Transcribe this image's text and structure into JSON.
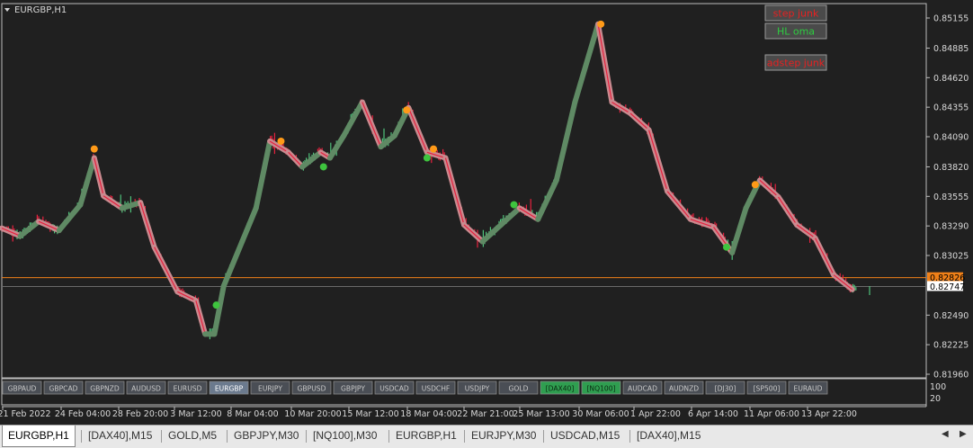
{
  "chart": {
    "title": "EURGBP,H1",
    "collapse_icon": "triangle-down-icon",
    "price_ticks": [
      "0.85155",
      "0.84885",
      "0.84620",
      "0.84355",
      "0.84090",
      "0.83820",
      "0.83555",
      "0.83290",
      "0.83025",
      "0.82490",
      "0.82225",
      "0.81960"
    ],
    "price_tick_values": [
      0.85155,
      0.84885,
      0.8462,
      0.84355,
      0.8409,
      0.8382,
      0.83555,
      0.8329,
      0.83025,
      0.8249,
      0.82225,
      0.8196
    ],
    "orange_price": "0.82826",
    "current_price": "0.82747",
    "time_ticks": [
      "21 Feb 2022",
      "24 Feb 04:00",
      "28 Feb 20:00",
      "3 Mar 12:00",
      "8 Mar 04:00",
      "10 Mar 20:00",
      "15 Mar 12:00",
      "18 Mar 04:00",
      "22 Mar 21:00",
      "25 Mar 13:00",
      "30 Mar 06:00",
      "1 Apr 22:00",
      "6 Apr 14:00",
      "11 Apr 06:00",
      "13 Apr 22:00"
    ],
    "subwindow_ticks": [
      "100",
      "20"
    ],
    "colors": {
      "background": "#202020",
      "up_bars": "#4fc27a",
      "down_bars": "#e8203e",
      "trend_up": "#5f8a64",
      "trend_down": "#c98a8f",
      "orange_line": "#f08018",
      "marker_orange": "#ff9a18",
      "marker_green": "#3ec43e"
    },
    "indicator_buttons": [
      {
        "label": "step junk",
        "text_color": "#e82020",
        "bg": "#4a4a4a",
        "icon": ""
      },
      {
        "label": "HL oma",
        "text_color": "#2ecc40",
        "bg": "#4a4a4a",
        "icon": ""
      },
      {
        "label": "adstep junk",
        "text_color": "#e82020",
        "bg": "#4a4a4a",
        "icon": ""
      }
    ]
  },
  "symbol_buttons": [
    {
      "label": "GBPAUD",
      "state": "normal"
    },
    {
      "label": "GBPCAD",
      "state": "normal"
    },
    {
      "label": "GBPNZD",
      "state": "normal"
    },
    {
      "label": "AUDUSD",
      "state": "normal"
    },
    {
      "label": "EURUSD",
      "state": "normal"
    },
    {
      "label": "EURGBP",
      "state": "selected"
    },
    {
      "label": "EURJPY",
      "state": "normal"
    },
    {
      "label": "GBPUSD",
      "state": "normal"
    },
    {
      "label": "GBPJPY",
      "state": "normal"
    },
    {
      "label": "USDCAD",
      "state": "normal"
    },
    {
      "label": "USDCHF",
      "state": "normal"
    },
    {
      "label": "USDJPY",
      "state": "normal"
    },
    {
      "label": "GOLD",
      "state": "normal"
    },
    {
      "label": "[DAX40]",
      "state": "green"
    },
    {
      "label": "[NQ100]",
      "state": "green"
    },
    {
      "label": "AUDCAD",
      "state": "normal"
    },
    {
      "label": "AUDNZD",
      "state": "normal"
    },
    {
      "label": "[DJ30]",
      "state": "normal"
    },
    {
      "label": "[SP500]",
      "state": "normal"
    },
    {
      "label": "EURAUD",
      "state": "normal"
    }
  ],
  "tabs": [
    {
      "label": "EURGBP,H1",
      "active": true
    },
    {
      "label": "[DAX40],M15",
      "active": false
    },
    {
      "label": "GOLD,M5",
      "active": false
    },
    {
      "label": "GBPJPY,M30",
      "active": false
    },
    {
      "label": "[NQ100],M30",
      "active": false
    },
    {
      "label": "EURGBP,H1",
      "active": false
    },
    {
      "label": "EURJPY,M30",
      "active": false
    },
    {
      "label": "USDCAD,M15",
      "active": false
    },
    {
      "label": "[DAX40],M15",
      "active": false
    }
  ],
  "tab_scroll": {
    "left_icon": "arrow-left-icon",
    "right_icon": "arrow-right-icon"
  },
  "chart_data": {
    "type": "line",
    "title": "EURGBP,H1",
    "price_axis": "right",
    "trend_line": [
      {
        "t": 0.0,
        "p": 0.8327
      },
      {
        "t": 0.02,
        "p": 0.832
      },
      {
        "t": 0.04,
        "p": 0.8333
      },
      {
        "t": 0.062,
        "p": 0.8325
      },
      {
        "t": 0.085,
        "p": 0.8348
      },
      {
        "t": 0.1,
        "p": 0.839
      },
      {
        "t": 0.11,
        "p": 0.8356
      },
      {
        "t": 0.13,
        "p": 0.8345
      },
      {
        "t": 0.15,
        "p": 0.835
      },
      {
        "t": 0.165,
        "p": 0.831
      },
      {
        "t": 0.19,
        "p": 0.827
      },
      {
        "t": 0.21,
        "p": 0.8262
      },
      {
        "t": 0.22,
        "p": 0.8232
      },
      {
        "t": 0.23,
        "p": 0.8232
      },
      {
        "t": 0.24,
        "p": 0.8275
      },
      {
        "t": 0.26,
        "p": 0.8315
      },
      {
        "t": 0.275,
        "p": 0.8345
      },
      {
        "t": 0.29,
        "p": 0.8405
      },
      {
        "t": 0.31,
        "p": 0.8395
      },
      {
        "t": 0.325,
        "p": 0.8382
      },
      {
        "t": 0.345,
        "p": 0.8395
      },
      {
        "t": 0.355,
        "p": 0.839
      },
      {
        "t": 0.37,
        "p": 0.841
      },
      {
        "t": 0.39,
        "p": 0.844
      },
      {
        "t": 0.41,
        "p": 0.84
      },
      {
        "t": 0.425,
        "p": 0.841
      },
      {
        "t": 0.44,
        "p": 0.8435
      },
      {
        "t": 0.46,
        "p": 0.8395
      },
      {
        "t": 0.48,
        "p": 0.839
      },
      {
        "t": 0.5,
        "p": 0.833
      },
      {
        "t": 0.52,
        "p": 0.8315
      },
      {
        "t": 0.54,
        "p": 0.833
      },
      {
        "t": 0.56,
        "p": 0.8345
      },
      {
        "t": 0.58,
        "p": 0.8335
      },
      {
        "t": 0.6,
        "p": 0.837
      },
      {
        "t": 0.62,
        "p": 0.844
      },
      {
        "t": 0.645,
        "p": 0.851
      },
      {
        "t": 0.66,
        "p": 0.844
      },
      {
        "t": 0.68,
        "p": 0.843
      },
      {
        "t": 0.7,
        "p": 0.8415
      },
      {
        "t": 0.72,
        "p": 0.836
      },
      {
        "t": 0.745,
        "p": 0.8335
      },
      {
        "t": 0.77,
        "p": 0.8328
      },
      {
        "t": 0.79,
        "p": 0.8305
      },
      {
        "t": 0.805,
        "p": 0.8345
      },
      {
        "t": 0.82,
        "p": 0.837
      },
      {
        "t": 0.84,
        "p": 0.8355
      },
      {
        "t": 0.86,
        "p": 0.833
      },
      {
        "t": 0.88,
        "p": 0.8318
      },
      {
        "t": 0.9,
        "p": 0.8285
      },
      {
        "t": 0.92,
        "p": 0.8272
      }
    ],
    "markers": [
      {
        "t": 0.1,
        "p": 0.8398,
        "kind": "orange"
      },
      {
        "t": 0.232,
        "p": 0.8258,
        "kind": "green"
      },
      {
        "t": 0.302,
        "p": 0.8405,
        "kind": "orange"
      },
      {
        "t": 0.348,
        "p": 0.8382,
        "kind": "green"
      },
      {
        "t": 0.438,
        "p": 0.8433,
        "kind": "orange"
      },
      {
        "t": 0.46,
        "p": 0.839,
        "kind": "green"
      },
      {
        "t": 0.467,
        "p": 0.8398,
        "kind": "orange"
      },
      {
        "t": 0.554,
        "p": 0.8348,
        "kind": "green"
      },
      {
        "t": 0.648,
        "p": 0.851,
        "kind": "orange"
      },
      {
        "t": 0.784,
        "p": 0.831,
        "kind": "green"
      },
      {
        "t": 0.815,
        "p": 0.8366,
        "kind": "orange"
      }
    ]
  }
}
